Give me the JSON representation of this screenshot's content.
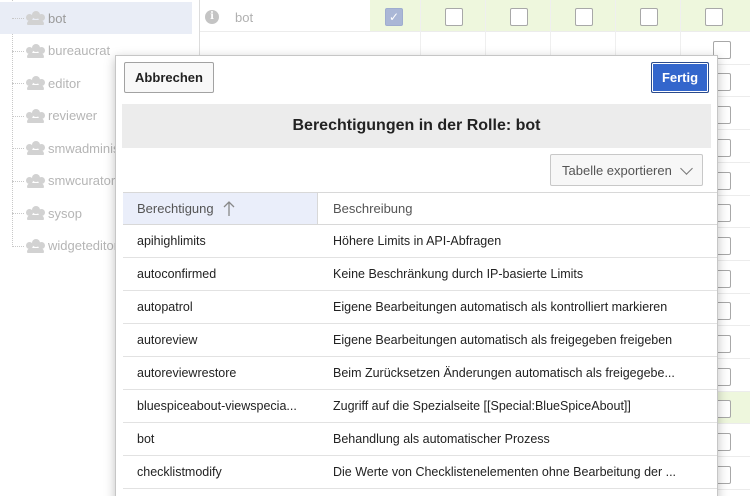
{
  "tree": {
    "groups": [
      {
        "label": "bot",
        "selected": true
      },
      {
        "label": "bureaucrat",
        "selected": false
      },
      {
        "label": "editor",
        "selected": false
      },
      {
        "label": "reviewer",
        "selected": false
      },
      {
        "label": "smwadminis",
        "selected": false
      },
      {
        "label": "smwcurator",
        "selected": false
      },
      {
        "label": "sysop",
        "selected": false
      },
      {
        "label": "widgeteditor",
        "selected": false
      }
    ],
    "icon": "users-group-icon"
  },
  "grid": {
    "first_row_label": "bot",
    "first_row_icon": "info-icon",
    "info_glyph": "i",
    "checked_glyph": "✓",
    "highlight_color": "#eef7dd"
  },
  "dialog": {
    "cancel_label": "Abbrechen",
    "done_label": "Fertig",
    "title": "Berechtigungen in der Rolle: bot",
    "export_label": "Tabelle exportieren",
    "export_icon": "chevron-down-icon",
    "accent_color": "#3366cc",
    "table": {
      "headers": [
        "Berechtigung",
        "Beschreibung"
      ],
      "sort_icon": "sort-ascending-arrow-icon",
      "rows": [
        {
          "permission": "apihighlimits",
          "description": "Höhere Limits in API-Abfragen"
        },
        {
          "permission": "autoconfirmed",
          "description": "Keine Beschränkung durch IP-basierte Limits"
        },
        {
          "permission": "autopatrol",
          "description": "Eigene Bearbeitungen automatisch als kontrolliert markieren"
        },
        {
          "permission": "autoreview",
          "description": "Eigene Bearbeitungen automatisch als freigegeben freigeben"
        },
        {
          "permission": "autoreviewrestore",
          "description": "Beim Zurücksetzen Änderungen automatisch als freigegebe..."
        },
        {
          "permission": "bluespiceabout-viewspecia...",
          "description": "Zugriff auf die Spezialseite [[Special:BlueSpiceAbout]]"
        },
        {
          "permission": "bot",
          "description": "Behandlung als automatischer Prozess"
        },
        {
          "permission": "checklistmodify",
          "description": "Die Werte von Checklistenelementen ohne Bearbeitung der ..."
        }
      ]
    }
  }
}
